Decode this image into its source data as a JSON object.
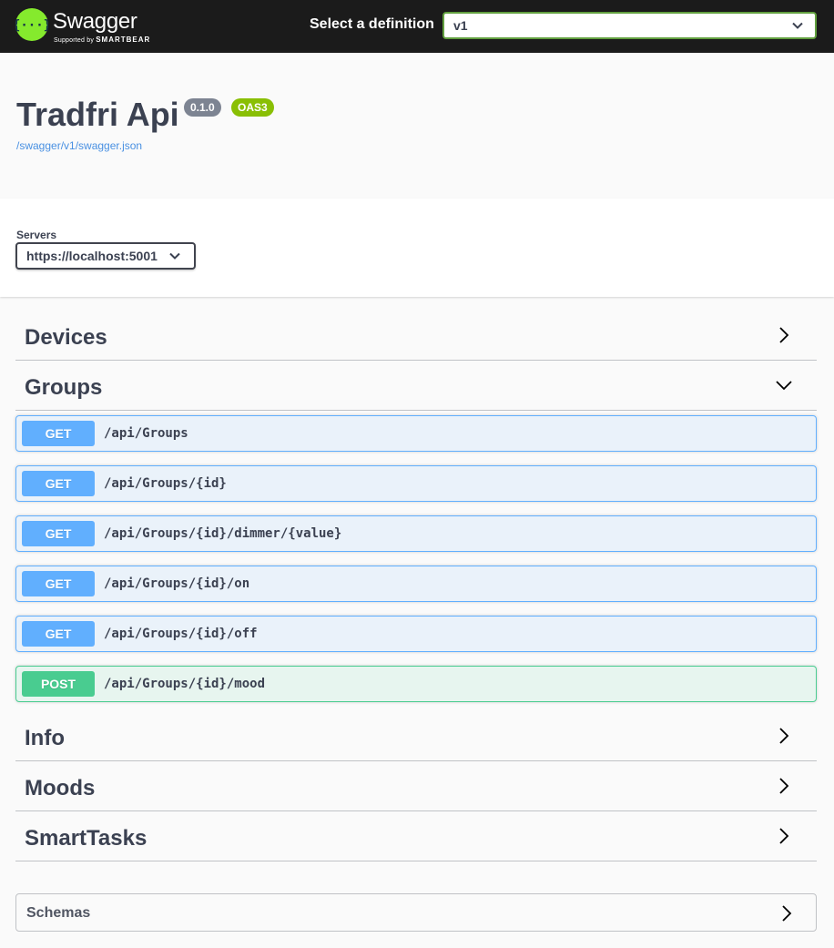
{
  "topbar": {
    "brand": "Swagger",
    "brand_sub_prefix": "Supported by",
    "brand_sub_company": "SMARTBEAR",
    "definition_label": "Select a definition",
    "definition_value": "v1"
  },
  "info": {
    "title": "Tradfri Api",
    "version_badge": "0.1.0",
    "oas_badge": "OAS3",
    "spec_url": "/swagger/v1/swagger.json"
  },
  "servers": {
    "label": "Servers",
    "selected": "https://localhost:5001"
  },
  "tags": [
    {
      "name": "Devices",
      "expanded": false
    },
    {
      "name": "Groups",
      "expanded": true
    },
    {
      "name": "Info",
      "expanded": false
    },
    {
      "name": "Moods",
      "expanded": false
    },
    {
      "name": "SmartTasks",
      "expanded": false
    }
  ],
  "operations": [
    {
      "method": "GET",
      "path": "/api/Groups"
    },
    {
      "method": "GET",
      "path": "/api/Groups/{id}"
    },
    {
      "method": "GET",
      "path": "/api/Groups/{id}/dimmer/{value}"
    },
    {
      "method": "GET",
      "path": "/api/Groups/{id}/on"
    },
    {
      "method": "GET",
      "path": "/api/Groups/{id}/off"
    },
    {
      "method": "POST",
      "path": "/api/Groups/{id}/mood"
    }
  ],
  "schemas": {
    "label": "Schemas"
  },
  "colors": {
    "get": "#61affe",
    "post": "#49cc90",
    "topbar": "#1b1b1b",
    "logo": "#85ea2d",
    "link": "#4990e2"
  }
}
